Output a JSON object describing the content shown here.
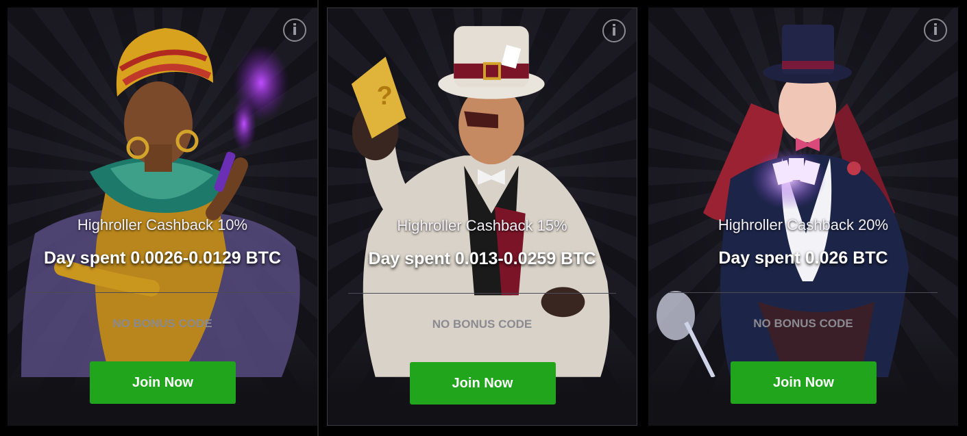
{
  "cards": [
    {
      "title": "Highroller Cashback 10%",
      "spent": "Day spent 0.0026-0.0129 BTC",
      "code": "NO BONUS CODE",
      "button": "Join Now",
      "info": "i",
      "character": "turban-priestess-illustration"
    },
    {
      "title": "Highroller Cashback 15%",
      "spent": "Day spent 0.013-0.0259 BTC",
      "code": "NO BONUS CODE",
      "button": "Join Now",
      "info": "i",
      "character": "white-suit-gambler-illustration"
    },
    {
      "title": "Highroller Cashback 20%",
      "spent": "Day spent 0.026 BTC",
      "code": "NO BONUS CODE",
      "button": "Join Now",
      "info": "i",
      "character": "magician-woman-illustration"
    }
  ],
  "colors": {
    "button": "#21a51c",
    "background": "#131219",
    "muted_text": "#8a8a90"
  }
}
